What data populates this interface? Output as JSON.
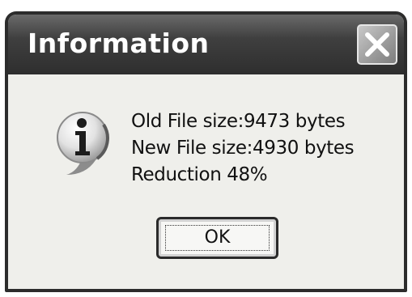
{
  "dialog": {
    "title": "Information",
    "close_icon": "close-icon",
    "icon": "info-icon",
    "message_lines": [
      "Old File size:9473 bytes",
      "New File size:4930 bytes",
      "Reduction 48%"
    ],
    "ok_label": "OK"
  }
}
